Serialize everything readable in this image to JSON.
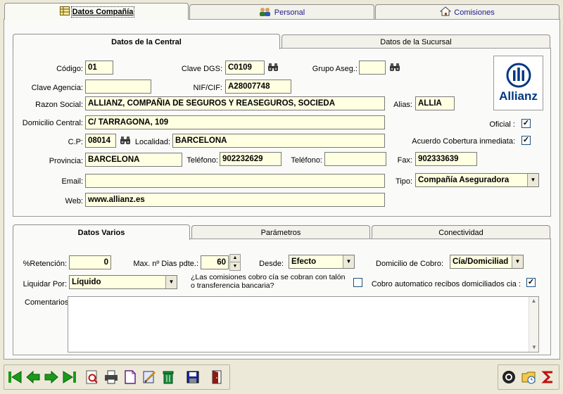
{
  "main_tabs": [
    {
      "label": "Datos Compañía",
      "icon": "grid-icon"
    },
    {
      "label": "Personal",
      "icon": "people-icon"
    },
    {
      "label": "Comisiones",
      "icon": "house-icon"
    }
  ],
  "central_tabs": [
    {
      "label": "Datos de la Central"
    },
    {
      "label": "Datos de la Sucursal"
    }
  ],
  "central": {
    "codigo_label": "Código:",
    "codigo": "01",
    "clave_dgs_label": "Clave DGS:",
    "clave_dgs": "C0109",
    "grupo_aseg_label": "Grupo Aseg.:",
    "grupo_aseg": "",
    "clave_agencia_label": "Clave Agencia:",
    "clave_agencia": "",
    "nif_label": "NIF/CIF:",
    "nif": "A28007748",
    "razon_social_label": "Razon Social:",
    "razon_social": "ALLIANZ, COMPAÑIA DE SEGUROS Y REASEGUROS, SOCIEDA",
    "alias_label": "Alias:",
    "alias": "ALLIA",
    "domicilio_label": "Domicilio Central:",
    "domicilio": "C/ TARRAGONA, 109",
    "oficial_label": "Oficial :",
    "oficial_checked": "✓",
    "cp_label": "C.P:",
    "cp": "08014",
    "localidad_label": "Localidad:",
    "localidad": "BARCELONA",
    "acuerdo_label": "Acuerdo Cobertura inmediata:",
    "acuerdo_checked": "✓",
    "provincia_label": "Provincia:",
    "provincia": "BARCELONA",
    "telefono1_label": "Teléfono:",
    "telefono1": "902232629",
    "telefono2_label": "Teléfono:",
    "telefono2": "",
    "fax_label": "Fax:",
    "fax": "902333639",
    "email_label": "Email:",
    "email": "",
    "tipo_label": "Tipo:",
    "tipo": "Compañía Aseguradora",
    "web_label": "Web:",
    "web": "www.allianz.es",
    "logo_text": "Allianz",
    "logo_color": "#003781"
  },
  "varios_tabs": [
    {
      "label": "Datos Varios"
    },
    {
      "label": "Parámetros"
    },
    {
      "label": "Conectividad"
    }
  ],
  "varios": {
    "retencion_label": "%Retención:",
    "retencion": "0",
    "max_dias_label": "Max. nº Dias pdte.:",
    "max_dias": "60",
    "desde_label": "Desde:",
    "desde": "Efecto",
    "domicilio_cobro_label": "Domicilio de Cobro:",
    "domicilio_cobro": "Cía/Domiciliad",
    "liquidar_label": "Liquidar Por:",
    "liquidar": "Líquido",
    "comisiones_q_line1": "¿Las comisiones cobro cía se cobran con talón",
    "comisiones_q_line2": "o transferencia bancaria?",
    "cobro_auto_label": "Cobro automatico recibos domiciliados cia :",
    "cobro_auto_checked": "✓",
    "comentarios_label": "Comentarios:",
    "comentarios": ""
  }
}
